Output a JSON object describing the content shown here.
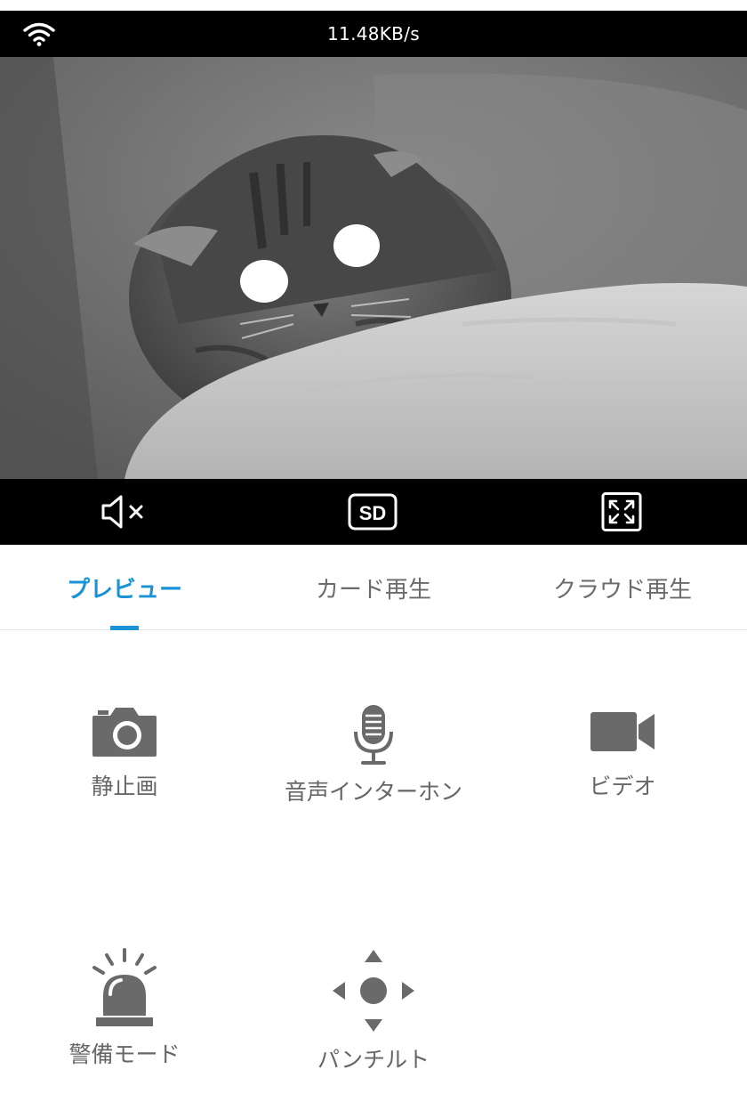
{
  "status": {
    "speed": "11.48KB/s",
    "wifi_icon": "wifi-icon"
  },
  "video_feed": {
    "description_icon": "camera-feed-image"
  },
  "controls": {
    "mute_icon": "speaker-mute-icon",
    "quality_label": "SD",
    "fullscreen_icon": "fullscreen-icon"
  },
  "tabs": [
    {
      "label": "プレビュー",
      "active": true
    },
    {
      "label": "カード再生",
      "active": false
    },
    {
      "label": "クラウド再生",
      "active": false
    }
  ],
  "features": [
    {
      "label": "静止画",
      "icon": "camera-icon"
    },
    {
      "label": "音声インターホン",
      "icon": "microphone-icon"
    },
    {
      "label": "ビデオ",
      "icon": "video-camera-icon"
    },
    {
      "label": "警備モード",
      "icon": "alarm-siren-icon"
    },
    {
      "label": "パンチルト",
      "icon": "pan-tilt-icon"
    }
  ],
  "colors": {
    "accent": "#1a93d6",
    "icon_gray": "#6a6a6a",
    "bar_black": "#000000"
  }
}
